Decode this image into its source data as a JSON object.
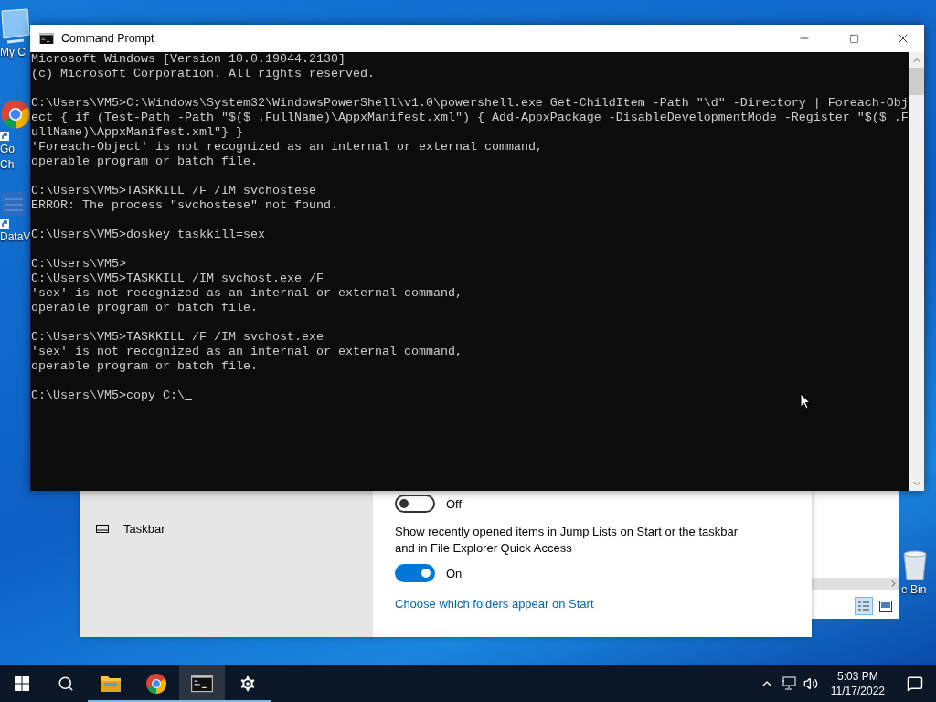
{
  "desktop_icons": [
    {
      "kind": "computer",
      "label_lines": [
        "My C"
      ]
    },
    {
      "kind": "chrome",
      "label_lines": [
        "Go",
        "Ch"
      ]
    },
    {
      "kind": "app",
      "label_lines": [
        "DataV"
      ]
    },
    {
      "kind": "bin",
      "label_lines": [
        "e Bin"
      ]
    }
  ],
  "settings_window": {
    "sidebar_items": [
      {
        "label": "Taskbar"
      }
    ],
    "settings": [
      {
        "kind": "toggle",
        "on": false,
        "state_label": "Off"
      },
      {
        "kind": "toggle",
        "description": "Show recently opened items in Jump Lists on Start or the taskbar and in File Explorer Quick Access",
        "on": true,
        "state_label": "On"
      },
      {
        "kind": "link",
        "label": "Choose which folders appear on Start"
      }
    ]
  },
  "explorer_window": {
    "view_buttons": [
      {
        "kind": "details",
        "selected": true
      },
      {
        "kind": "large",
        "selected": false
      }
    ]
  },
  "window": {
    "title": "Command Prompt",
    "console_blocks": [
      [
        "Microsoft Windows [Version 10.0.19044.2130]",
        "(c) Microsoft Corporation. All rights reserved."
      ],
      [
        "C:\\Users\\VM5>C:\\Windows\\System32\\WindowsPowerShell\\v1.0\\powershell.exe Get-ChildItem -Path \"\\d\" -Directory | Foreach-Obj",
        "ect { if (Test-Path -Path \"$($_.FullName)\\AppxManifest.xml\") { Add-AppxPackage -DisableDevelopmentMode -Register \"$($_.F",
        "ullName)\\AppxManifest.xml\"} }",
        "'Foreach-Object' is not recognized as an internal or external command,",
        "operable program or batch file."
      ],
      [
        "C:\\Users\\VM5>TASKKILL /F /IM svchostese",
        "ERROR: The process \"svchostese\" not found."
      ],
      [
        "C:\\Users\\VM5>doskey taskkill=sex"
      ],
      [
        "C:\\Users\\VM5>",
        "C:\\Users\\VM5>TASKKILL /IM svchost.exe /F",
        "'sex' is not recognized as an internal or external command,",
        "operable program or batch file."
      ],
      [
        "C:\\Users\\VM5>TASKKILL /F /IM svchost.exe",
        "'sex' is not recognized as an internal or external command,",
        "operable program or batch file."
      ],
      [
        "C:\\Users\\VM5>copy C:\\"
      ]
    ]
  },
  "taskbar": {
    "apps": [
      {
        "kind": "explorer",
        "running": true,
        "selected": false
      },
      {
        "kind": "chrome",
        "running": true,
        "selected": false
      },
      {
        "kind": "cmd",
        "running": true,
        "selected": true
      },
      {
        "kind": "settings",
        "running": true,
        "selected": false
      }
    ],
    "time": "5:03 PM",
    "date": "11/17/2022"
  }
}
